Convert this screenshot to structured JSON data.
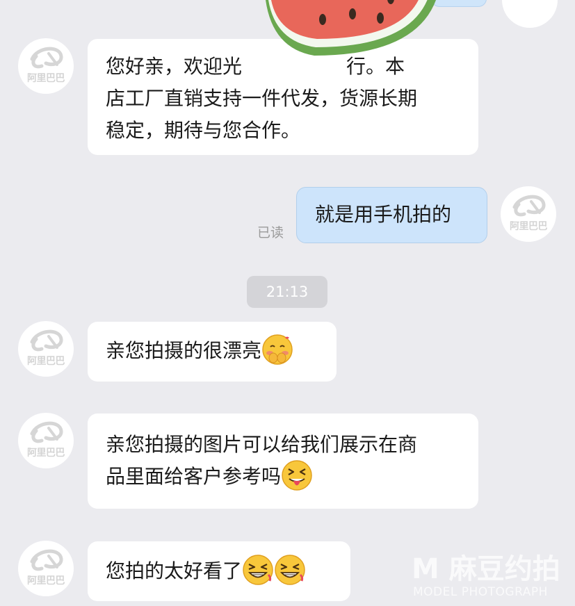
{
  "colors": {
    "background": "#ebebef",
    "received_bubble": "#ffffff",
    "sent_bubble": "#cde4fb",
    "time_pill": "#d4d4d8"
  },
  "avatar": {
    "logo_text": "阿里巴巴",
    "icon": "alibaba-logo-icon"
  },
  "messages": [
    {
      "direction": "received",
      "lines": [
        "您好亲，欢迎光临",
        "店工厂直销支持一件代发，货源长期",
        "稳定，期待与您合作。"
      ],
      "first_line_visible": "您好亲，欢迎光",
      "first_line_tail": "行。本"
    },
    {
      "direction": "sent",
      "lines": [
        "就是用手机拍的"
      ],
      "status": "已读"
    },
    {
      "direction": "received",
      "lines": [
        "亲您拍摄的很漂亮"
      ],
      "emoji": [
        "shy-blush-emoji"
      ]
    },
    {
      "direction": "received",
      "lines": [
        "亲您拍摄的图片可以给我们展示在商",
        "品里面给客户参考吗"
      ],
      "emoji": [
        "tongue-out-emoji"
      ]
    },
    {
      "direction": "received",
      "lines": [
        "您拍的太好看了"
      ],
      "emoji": [
        "laughing-emoji",
        "laughing-emoji"
      ]
    }
  ],
  "timestamp": "21:13",
  "sticker": {
    "icon": "watermelon-sticker-icon"
  },
  "watermark": {
    "main": "M 麻豆约拍",
    "sub": "MODEL PHOTOGRAPH"
  }
}
